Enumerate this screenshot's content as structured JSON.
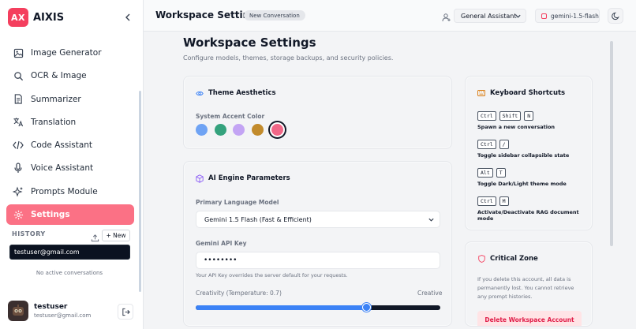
{
  "brand": {
    "logo": "AX",
    "name": "AIXIS"
  },
  "sidebar": {
    "items": [
      {
        "label": "Image Generator",
        "icon": "image-icon"
      },
      {
        "label": "OCR & Image",
        "icon": "search-icon"
      },
      {
        "label": "Summarizer",
        "icon": "document-icon"
      },
      {
        "label": "Translation",
        "icon": "translate-icon"
      },
      {
        "label": "Code Assistant",
        "icon": "code-icon"
      },
      {
        "label": "Voice Assistant",
        "icon": "microphone-icon"
      },
      {
        "label": "Prompts Module",
        "icon": "sparkles-icon"
      },
      {
        "label": "Settings",
        "icon": "gear-icon",
        "active": true
      }
    ],
    "history": {
      "title": "HISTORY",
      "new_label": "+ New",
      "search_value": "testuser@gmail.com",
      "empty_text": "No active conversations"
    },
    "user": {
      "name": "testuser",
      "email": "testuser@gmail.com"
    }
  },
  "topbar": {
    "title": "Workspace Settings",
    "badge": "New Conversation",
    "assistant_select": "General Assistant",
    "model": "gemini-1.5-flash"
  },
  "main": {
    "title": "Workspace Settings",
    "subtitle": "Configure models, themes, storage backups, and security policies."
  },
  "theme_card": {
    "title": "Theme Aesthetics",
    "accent_label": "System Accent Color",
    "swatches": [
      "#6fa3f4",
      "#34a27d",
      "#c3a4f4",
      "#c28b2c",
      "#f16788"
    ],
    "selected_swatch": 4
  },
  "engine_card": {
    "title": "AI Engine Parameters",
    "model_label": "Primary Language Model",
    "model_value": "Gemini 1.5 Flash (Fast & Efficient)",
    "key_label": "Gemini API Key",
    "key_value": "••••••••",
    "key_help": "Your API Key overrides the server default for your requests.",
    "creativity_label": "Creativity (Temperature: 0.7)",
    "creativity_right": "Creative",
    "creativity_value": 0.7
  },
  "shortcuts_card": {
    "title": "Keyboard Shortcuts",
    "shortcuts": [
      {
        "keys": [
          "Ctrl",
          "Shift",
          "N"
        ],
        "desc": "Spawn a new conversation"
      },
      {
        "keys": [
          "Ctrl",
          "/"
        ],
        "desc": "Toggle sidebar collapsible state"
      },
      {
        "keys": [
          "Alt",
          "T"
        ],
        "desc": "Toggle Dark/Light theme mode"
      },
      {
        "keys": [
          "Ctrl",
          "M"
        ],
        "desc": "Activate/Deactivate RAG document mode"
      }
    ]
  },
  "critical_card": {
    "title": "Critical Zone",
    "text": "If you delete this account, all data is permanently lost. You cannot retrieve any prompt histories.",
    "delete_label": "Delete Workspace Account"
  },
  "colors": {
    "accent": "#fb7185",
    "brand": "#f43f5e",
    "slider": "#3b82f6"
  }
}
